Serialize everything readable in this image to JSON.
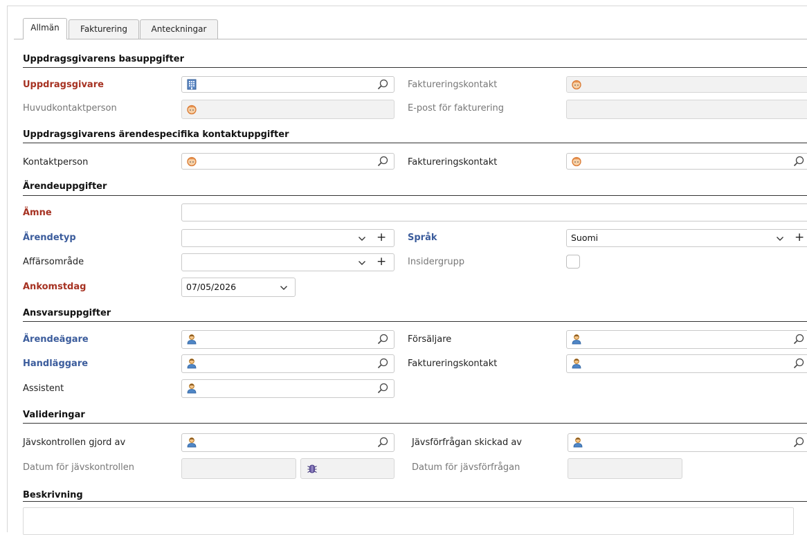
{
  "tabs": [
    "Allmän",
    "Fakturering",
    "Anteckningar"
  ],
  "sections": {
    "basic": "Uppdragsgivarens basuppgifter",
    "specific_contacts": "Uppdragsgivarens ärendespecifika kontaktuppgifter",
    "case": "Ärendeuppgifter",
    "responsibility": "Ansvarsuppgifter",
    "validations": "Valideringar",
    "description": "Beskrivning"
  },
  "labels": {
    "client": "Uppdragsgivare",
    "billing_contact": "Faktureringskontakt",
    "main_contact": "Huvudkontaktperson",
    "billing_email": "E-post för fakturering",
    "contact_person": "Kontaktperson",
    "billing_contact_2": "Faktureringskontakt",
    "subject": "Ämne",
    "case_type": "Ärendetyp",
    "language": "Språk",
    "business_area": "Affärsområde",
    "insider_group": "Insidergrupp",
    "arrival_date": "Ankomstdag",
    "case_owner": "Ärendeägare",
    "seller": "Försäljare",
    "handler": "Handläggare",
    "billing_contact_3": "Faktureringskontakt",
    "assistant": "Assistent",
    "conflict_check_by": "Jävskontrollen gjord av",
    "conflict_request_by": "Jävsförfrågan skickad av",
    "conflict_check_date": "Datum för jävskontrollen",
    "conflict_request_date": "Datum för jävsförfrågan"
  },
  "values": {
    "language": "Suomi",
    "arrival_date": "07/05/2026"
  },
  "colors": {
    "required": "#a63222",
    "mandatory_blue": "#3b5c9c",
    "disabled_bg": "#f2f2f2",
    "border": "#c9c9c9"
  }
}
